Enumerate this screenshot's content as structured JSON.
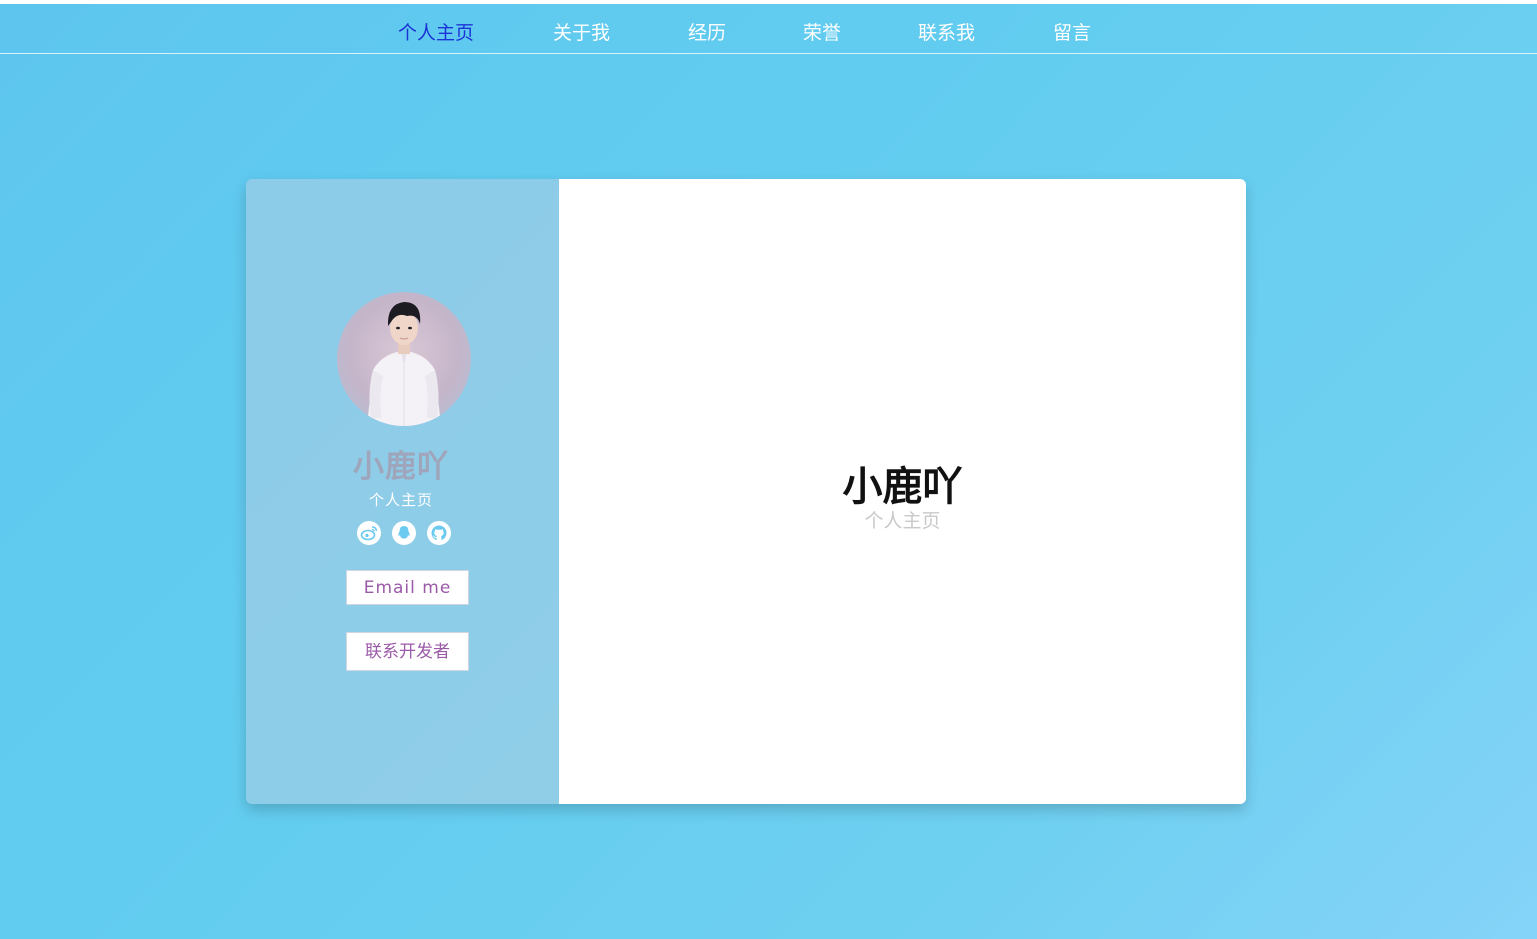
{
  "nav": {
    "items": [
      {
        "label": "个人主页",
        "active": true
      },
      {
        "label": "关于我",
        "active": false
      },
      {
        "label": "经历",
        "active": false
      },
      {
        "label": "荣誉",
        "active": false
      },
      {
        "label": "联系我",
        "active": false
      },
      {
        "label": "留言",
        "active": false
      }
    ]
  },
  "profile": {
    "name": "小鹿吖",
    "subtitle": "个人主页",
    "social_icons": [
      "weibo-icon",
      "qq-icon",
      "github-icon"
    ]
  },
  "buttons": {
    "email_label": "Email me",
    "contact_dev_label": "联系开发者"
  },
  "main": {
    "title": "小鹿吖",
    "subtitle": "个人主页"
  },
  "colors": {
    "background": "#63cdf0",
    "nav_active": "#1b34d6",
    "button_text": "#9b5aa8"
  }
}
